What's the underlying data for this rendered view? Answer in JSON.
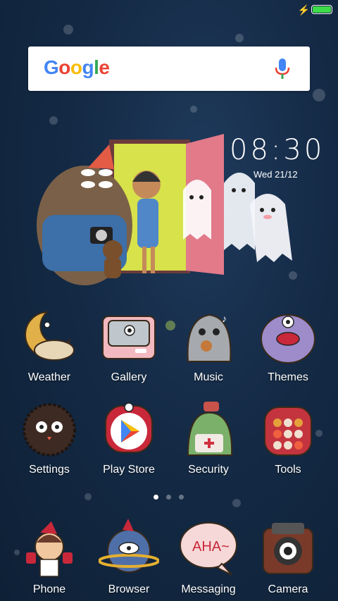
{
  "status_bar": {
    "charging_icon": "bolt-icon",
    "battery_level": 1.0,
    "battery_color": "#3ddc4a"
  },
  "search_widget": {
    "logo_text": "Google",
    "mic_icon": "mic-icon"
  },
  "clock_widget": {
    "time": "08:30",
    "date": "Wed 21/12"
  },
  "apps": [
    {
      "label": "Weather",
      "icon": "moon-weather-icon"
    },
    {
      "label": "Gallery",
      "icon": "gallery-tv-icon"
    },
    {
      "label": "Music",
      "icon": "music-ghost-icon"
    },
    {
      "label": "Themes",
      "icon": "themes-monster-icon"
    },
    {
      "label": "Settings",
      "icon": "settings-furball-icon"
    },
    {
      "label": "Play Store",
      "icon": "play-store-icon"
    },
    {
      "label": "Security",
      "icon": "security-monster-icon"
    },
    {
      "label": "Tools",
      "icon": "tools-folder-icon"
    }
  ],
  "page_indicator": {
    "pages": 3,
    "active": 1
  },
  "dock": [
    {
      "label": "Phone",
      "icon": "phone-kid-icon"
    },
    {
      "label": "Browser",
      "icon": "browser-planet-icon"
    },
    {
      "label": "Messaging",
      "icon": "messaging-bubble-icon"
    },
    {
      "label": "Camera",
      "icon": "camera-icon"
    }
  ],
  "colors": {
    "background": "#142a45",
    "google_blue": "#4285F4",
    "google_red": "#EA4335",
    "google_yellow": "#FBBC05",
    "google_green": "#34A853"
  }
}
